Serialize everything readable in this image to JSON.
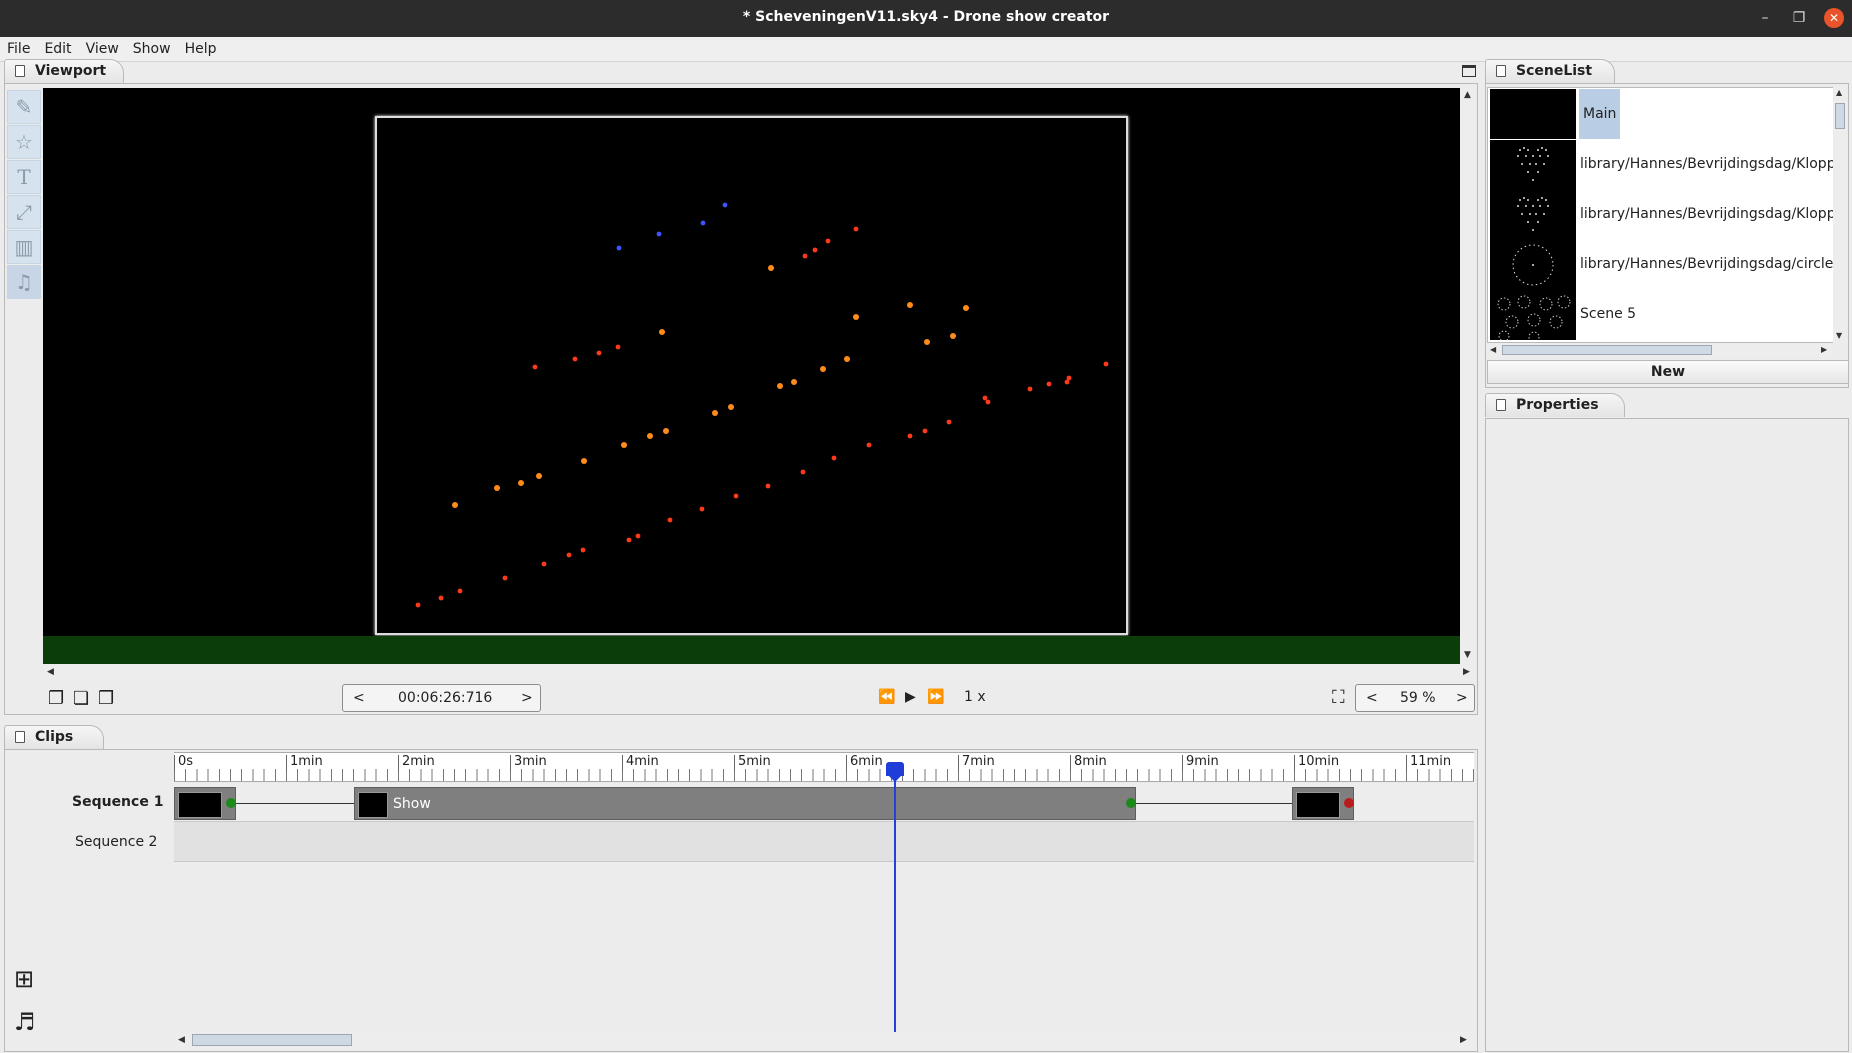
{
  "window": {
    "title": "* ScheveningenV11.sky4 - Drone show creator"
  },
  "menu": [
    "File",
    "Edit",
    "View",
    "Show",
    "Help"
  ],
  "viewport": {
    "tab": "Viewport",
    "tools": [
      "pencil-icon",
      "star-icon",
      "text-icon",
      "path-icon",
      "grid-icon",
      "music-icon"
    ],
    "time": "00:06:26:716",
    "prev": "<",
    "next": ">",
    "speed": "1 x",
    "zoom": "59 %",
    "colors": {
      "drone_red": "#ff3a1a",
      "drone_orange": "#ff8c1a",
      "drone_blue": "#3b55ff",
      "ground": "#0b3d0b"
    }
  },
  "scenelist": {
    "tab": "SceneList",
    "scenes": [
      {
        "label": "Main",
        "selected": true
      },
      {
        "label": "library/Hannes/Bevrijdingsdag/Kloppend",
        "selected": false
      },
      {
        "label": "library/Hannes/Bevrijdingsdag/Kloppend",
        "selected": false
      },
      {
        "label": "library/Hannes/Bevrijdingsdag/circles pla",
        "selected": false
      },
      {
        "label": "Scene 5",
        "selected": false
      }
    ],
    "new_button": "New"
  },
  "properties": {
    "tab": "Properties"
  },
  "clips": {
    "tab": "Clips",
    "ruler": [
      "0s",
      "1min",
      "2min",
      "3min",
      "4min",
      "5min",
      "6min",
      "7min",
      "8min",
      "9min",
      "10min",
      "11min"
    ],
    "sequences": [
      {
        "label": "Sequence 1",
        "bold": true
      },
      {
        "label": "Sequence 2",
        "bold": false
      }
    ],
    "clip_name": "Show"
  }
}
